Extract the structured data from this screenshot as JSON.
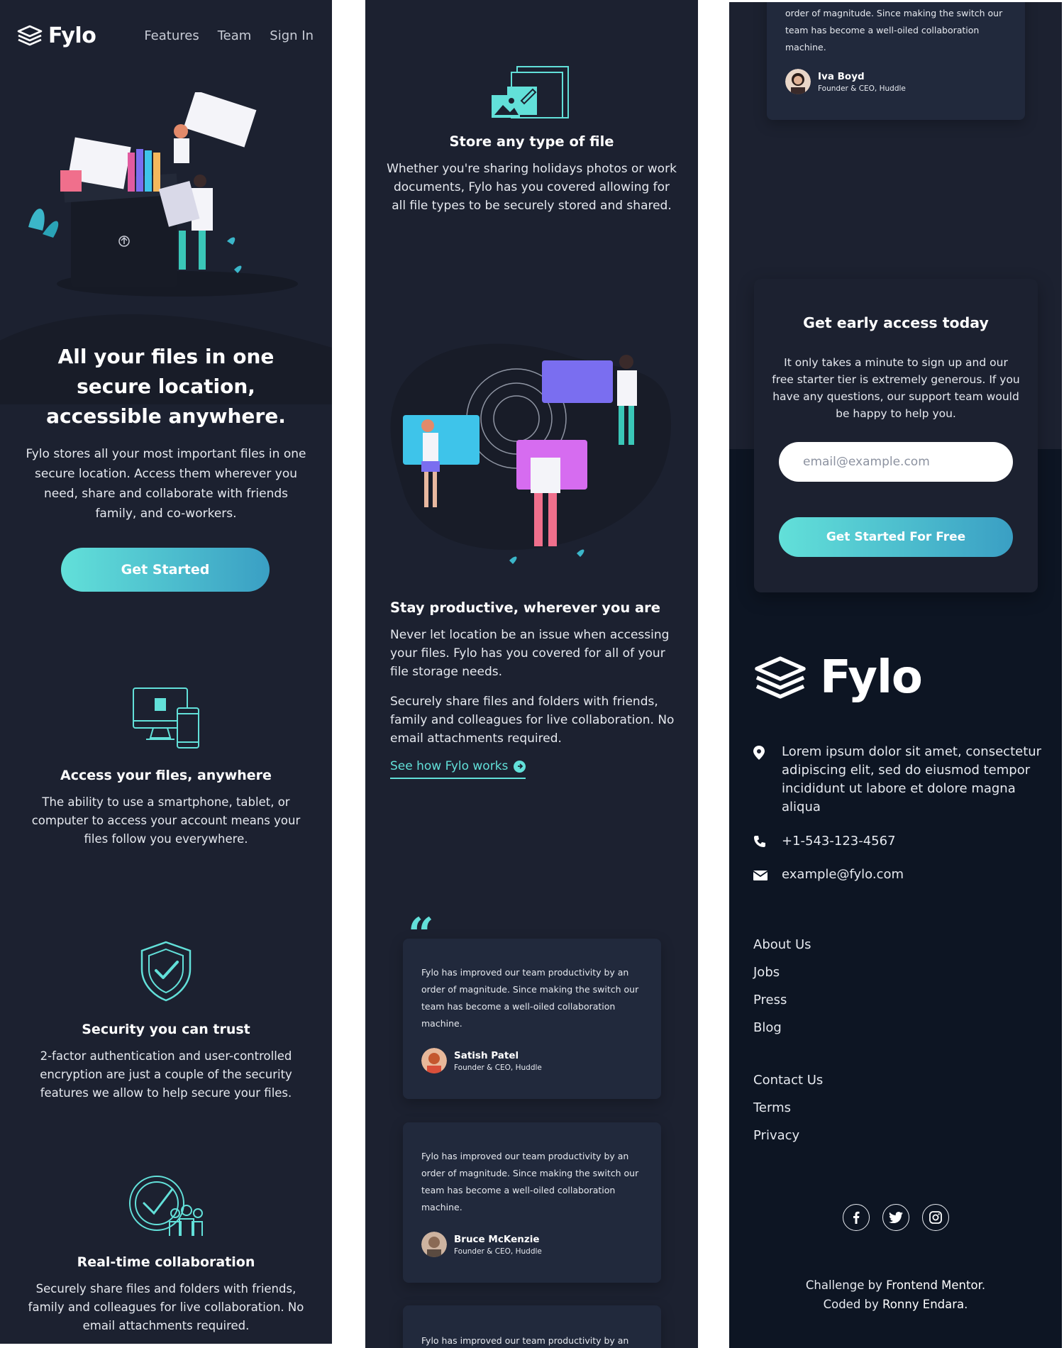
{
  "brand": {
    "name": "Fylo"
  },
  "nav": {
    "items": [
      "Features",
      "Team",
      "Sign In"
    ]
  },
  "hero": {
    "title": "All your files in one secure location, accessible anywhere.",
    "description": "Fylo stores all your most important files in one secure location. Access them wherever you need, share and collaborate with friends family, and co-workers.",
    "cta": "Get Started"
  },
  "features": [
    {
      "icon": "devices-icon",
      "title": "Access your files, anywhere",
      "description": "The ability to use a smartphone, tablet, or computer to access your account means your files follow you everywhere."
    },
    {
      "icon": "shield-check-icon",
      "title": "Security you can trust",
      "description": "2-factor authentication and user-controlled encryption are just a couple of the security features we allow to help secure your files."
    },
    {
      "icon": "team-check-icon",
      "title": "Real-time collaboration",
      "description": "Securely share files and folders with friends, family and colleagues for live collaboration. No email attachments required."
    },
    {
      "icon": "folder-files-icon",
      "title": "Store any type of file",
      "description": "Whether you're sharing holidays photos or work documents, Fylo has you covered allowing for all file types to be securely stored and shared."
    }
  ],
  "productive": {
    "title": "Stay productive, wherever you are",
    "p1": "Never let location be an issue when accessing your files. Fylo has you covered for all of your file storage needs.",
    "p2": "Securely share files and folders with friends, family and colleagues for live collaboration. No email attachments required.",
    "link": "See how Fylo works"
  },
  "testimonials": [
    {
      "quote": "Fylo has improved our team productivity by an order of magnitude. Since making the switch our team has become a well-oiled collaboration machine.",
      "name": "Satish Patel",
      "role": "Founder & CEO, Huddle"
    },
    {
      "quote": "Fylo has improved our team productivity by an order of magnitude. Since making the switch our team has become a well-oiled collaboration machine.",
      "name": "Bruce McKenzie",
      "role": "Founder & CEO, Huddle"
    },
    {
      "quote": "Fylo has improved our team productivity by an",
      "name": "",
      "role": ""
    },
    {
      "quote": "order of magnitude. Since making the switch our team has become a well-oiled collaboration machine.",
      "name": "Iva Boyd",
      "role": "Founder & CEO, Huddle"
    }
  ],
  "early_access": {
    "title": "Get early access today",
    "description": "It only takes a minute to sign up and our free starter tier is extremely generous. If you have any questions, our support team would be happy to help you.",
    "email_placeholder": "email@example.com",
    "button": "Get Started For Free"
  },
  "footer": {
    "address": "Lorem ipsum dolor sit amet, consectetur adipiscing elit, sed do eiusmod tempor incididunt ut labore et dolore magna aliqua",
    "phone": "+1-543-123-4567",
    "email": "example@fylo.com",
    "links_a": [
      "About Us",
      "Jobs",
      "Press",
      "Blog"
    ],
    "links_b": [
      "Contact Us",
      "Terms",
      "Privacy"
    ],
    "socials": [
      "facebook-icon",
      "twitter-icon",
      "instagram-icon"
    ],
    "credit_prefix": "Challenge by",
    "credit_fm": "Frontend Mentor",
    "credit_mid": "Coded by",
    "credit_author": "Ronny Endara"
  },
  "colors": {
    "bg": "#1c2130",
    "footer_bg": "#0d1523",
    "card": "#21293c",
    "accent": "#62e0d9",
    "accent_end": "#3a9fc4"
  }
}
